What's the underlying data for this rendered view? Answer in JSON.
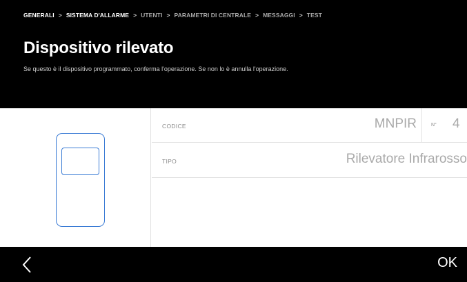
{
  "breadcrumb": {
    "items": [
      {
        "label": "GENERALI",
        "active": true
      },
      {
        "label": "SISTEMA D'ALLARME",
        "active": true
      },
      {
        "label": "UTENTI",
        "active": false
      },
      {
        "label": "PARAMETRI DI CENTRALE",
        "active": false
      },
      {
        "label": "MESSAGGI",
        "active": false
      },
      {
        "label": "TEST",
        "active": false
      }
    ],
    "separator": ">"
  },
  "header": {
    "title": "Dispositivo rilevato",
    "subtitle": "Se questo è il dispositivo programmato, conferma l'operazione. Se non lo è annulla l'operazione."
  },
  "device": {
    "icon": "motion-detector-icon",
    "accent_color": "#3a7bd5"
  },
  "fields": {
    "code_label": "CODICE",
    "code_value": "MNPIR",
    "number_label": "N°",
    "number_value": "4",
    "type_label": "TIPO",
    "type_value": "Rilevatore Infrarosso"
  },
  "footer": {
    "back_icon": "chevron-left-icon",
    "ok_label": "OK"
  }
}
